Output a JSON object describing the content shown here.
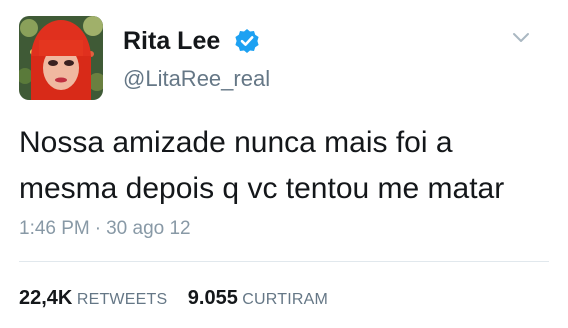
{
  "tweet": {
    "author": {
      "display_name": "Rita Lee",
      "handle": "@LitaRee_real",
      "verified_icon": "verified-badge-icon",
      "avatar_icon": "profile-avatar"
    },
    "menu_icon": "chevron-down-icon",
    "text_line_1": "Nossa amizade nunca mais foi a",
    "text_line_2": "mesma depois q vc tentou me matar",
    "time": "1:46 PM",
    "separator": "·",
    "date": "30 ago 12",
    "stats": {
      "retweets_count": "22,4K",
      "retweets_label": "RETWEETS",
      "likes_count": "9.055",
      "likes_label": "CURTIRAM"
    }
  },
  "colors": {
    "text_primary": "#14171a",
    "text_secondary": "#657786",
    "verified_blue": "#1da1f2",
    "divider": "#e1e8ed"
  }
}
